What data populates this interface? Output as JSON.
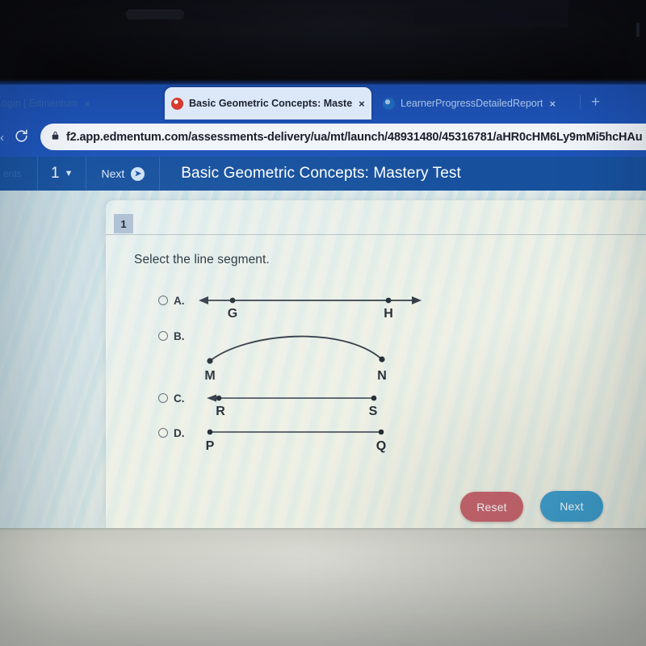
{
  "browser": {
    "tabs": [
      {
        "title": "duct Login | Edmentum",
        "favicon": "globe-icon",
        "active": false,
        "close_label": "×"
      },
      {
        "title": "Basic Geometric Concepts: Maste",
        "favicon": "edmentum-icon",
        "active": true,
        "close_label": "×"
      },
      {
        "title": "LearnerProgressDetailedReport",
        "favicon": "globe-icon",
        "active": false,
        "close_label": "×"
      }
    ],
    "new_tab_label": "+",
    "reload_label": "⟳",
    "back_label": "‹",
    "lock_icon": "padlock-icon",
    "url": "f2.app.edmentum.com/assessments-delivery/ua/mt/launch/48931480/45316781/aHR0cHM6Ly9mMi5hcHAu"
  },
  "app_toolbar": {
    "left_faded": "ents",
    "question_number": "1",
    "caret": "▼",
    "next_label": "Next",
    "next_icon_glyph": "➤",
    "title": "Basic Geometric Concepts: Mastery Test"
  },
  "question": {
    "number_badge": "1",
    "prompt": "Select the line segment.",
    "options": [
      {
        "letter": "A.",
        "figure": "line-with-two-arrows",
        "point_labels": [
          "G",
          "H"
        ],
        "selected": false
      },
      {
        "letter": "B.",
        "figure": "curved-arc",
        "point_labels": [
          "M",
          "N"
        ],
        "selected": false
      },
      {
        "letter": "C.",
        "figure": "ray-with-left-arrow",
        "point_labels": [
          "R",
          "S"
        ],
        "selected": false
      },
      {
        "letter": "D.",
        "figure": "line-segment",
        "point_labels": [
          "P",
          "Q"
        ],
        "selected": false
      }
    ]
  },
  "actions": {
    "reset_label": "Reset",
    "next_label": "Next"
  },
  "colors": {
    "browser_blue": "#1d52b4",
    "toolbar_blue": "#17519e",
    "reset_red": "#c4646c",
    "next_blue": "#3e9dcb",
    "badge_grey": "#aebfd4",
    "figure_ink": "#2b3440"
  }
}
